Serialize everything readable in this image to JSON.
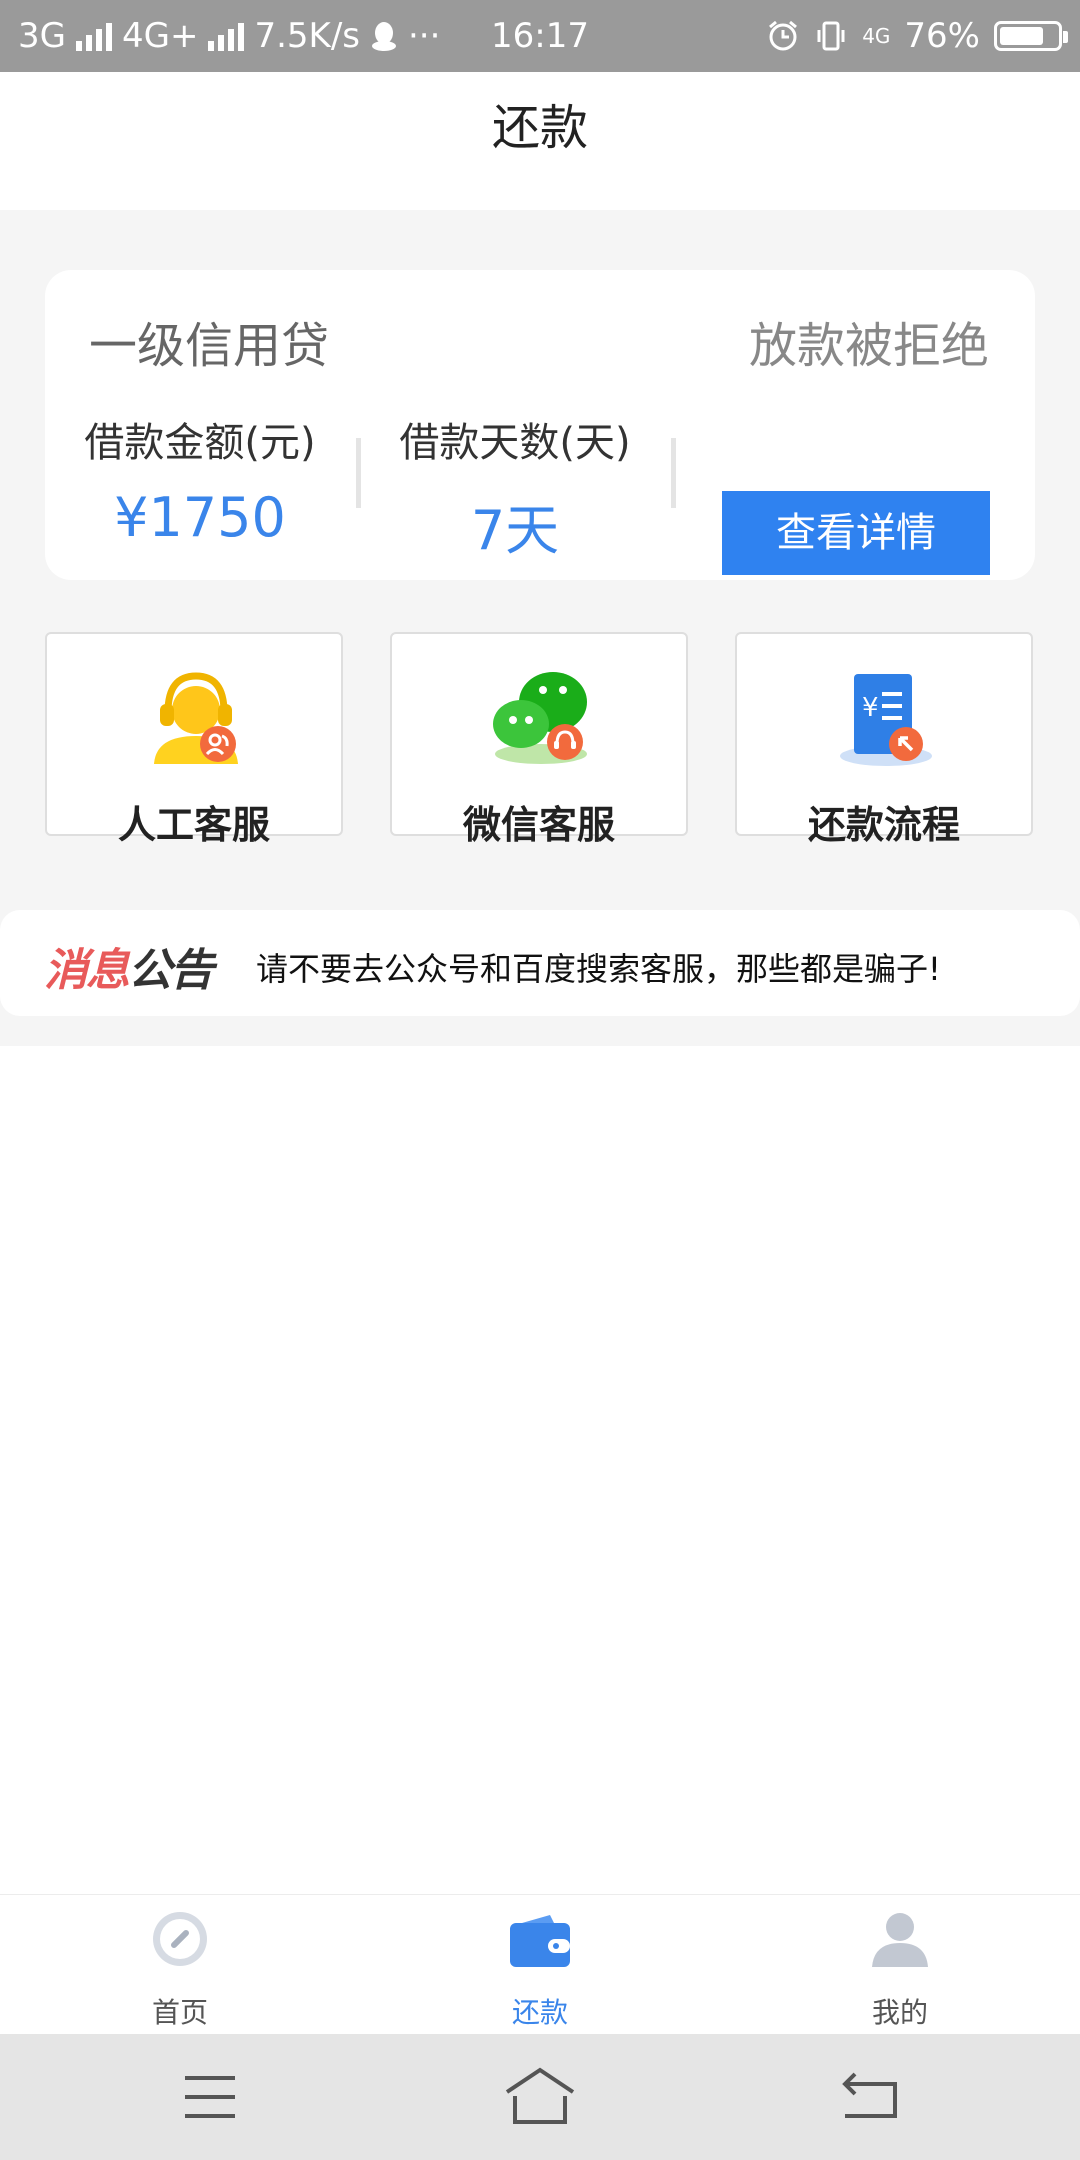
{
  "status_bar": {
    "network1": "3G",
    "network2": "4G+",
    "speed": "7.5K/s",
    "more": "···",
    "time": "16:17",
    "net_small": "4G",
    "battery_text": "76%",
    "battery_level": 0.76
  },
  "header": {
    "title": "还款"
  },
  "loan": {
    "product": "一级信用贷",
    "status": "放款被拒绝",
    "amount_label": "借款金额(元)",
    "amount_value": "¥1750",
    "days_label": "借款天数(天)",
    "days_value": "7天",
    "detail_button": "查看详情"
  },
  "services": [
    {
      "label": "人工客服"
    },
    {
      "label": "微信客服"
    },
    {
      "label": "还款流程"
    }
  ],
  "notice": {
    "badge_red": "消息",
    "badge_dark": "公告",
    "text": "请不要去公众号和百度搜索客服，那些都是骗子!"
  },
  "tabbar": [
    {
      "label": "首页"
    },
    {
      "label": "还款"
    },
    {
      "label": "我的"
    }
  ],
  "colors": {
    "accent": "#2f82f0",
    "value_blue": "#3a85ea",
    "background_gray": "#f5f5f5",
    "notice_red": "#e85a5a"
  }
}
